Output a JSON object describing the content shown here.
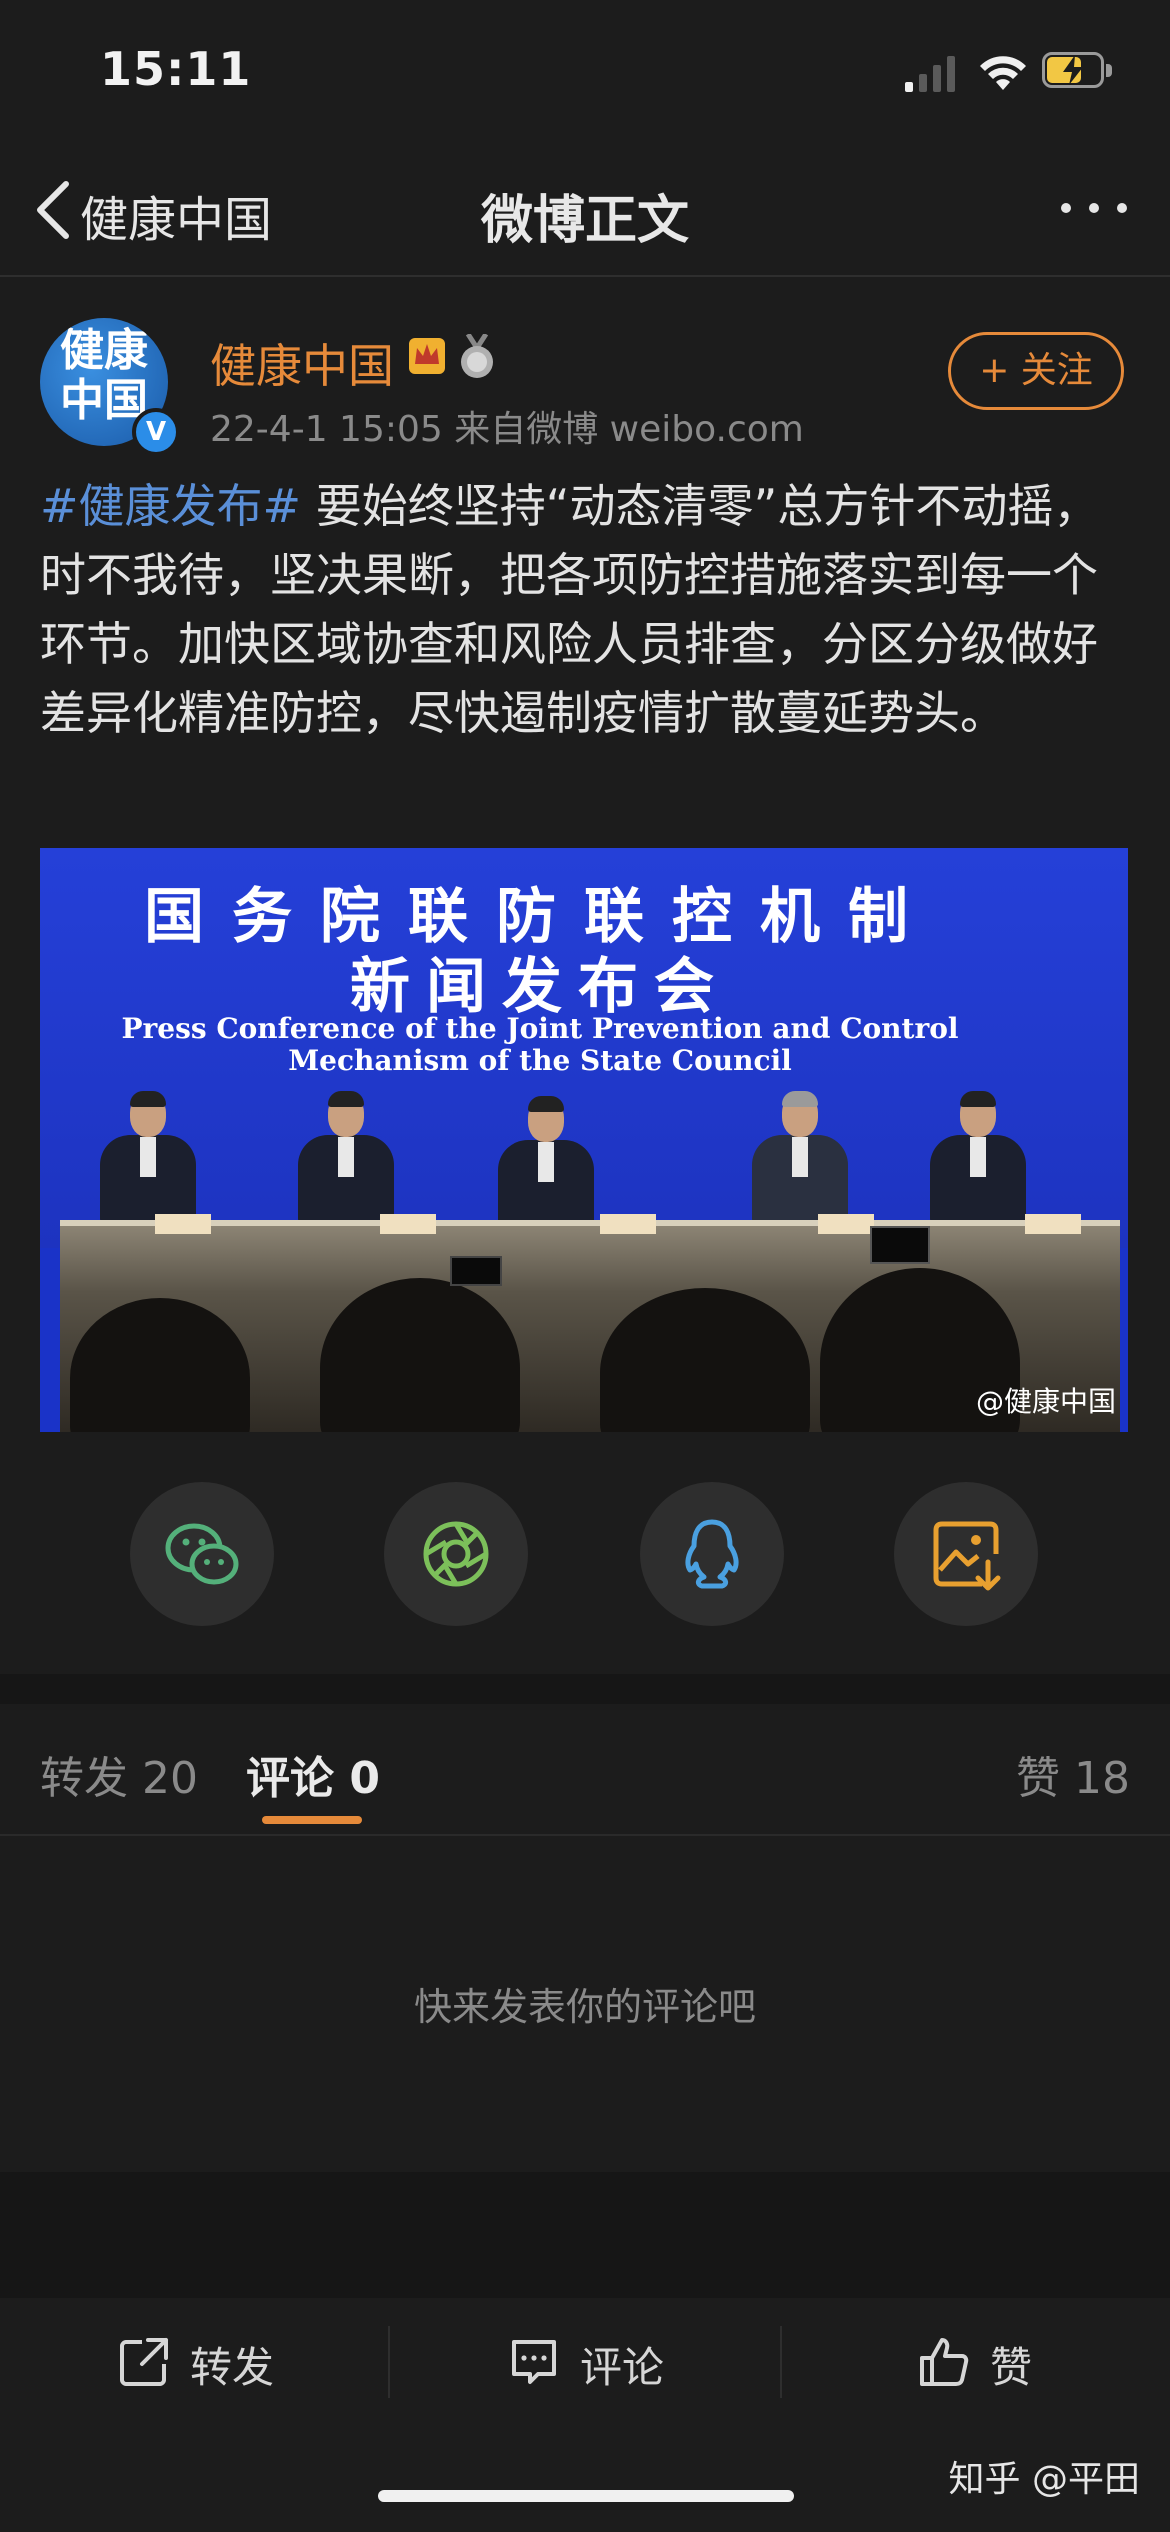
{
  "status_bar": {
    "time": "15:11"
  },
  "nav": {
    "back_label": "健康中国",
    "title": "微博正文"
  },
  "author": {
    "avatar_text": "健康中国",
    "name": "健康中国",
    "meta": "22-4-1 15:05  来自微博 weibo.com",
    "follow_label": "+ 关注"
  },
  "post": {
    "hashtag": "#健康发布#",
    "text": " 要始终坚持“动态清零”总方针不动摇，时不我待，坚决果断，把各项防控措施落实到每一个环节。加快区域协查和风险人员排查，分区分级做好差异化精准防控，尽快遏制疫情扩散蔓延势头。"
  },
  "image": {
    "title_cn_1": "国务院联防联控机制",
    "title_cn_2": "新闻发布会",
    "title_en_1": "Press Conference of the Joint Prevention and Control",
    "title_en_2": "Mechanism of the State Council",
    "watermark": "@健康中国"
  },
  "share": [
    "wechat-icon",
    "moments-icon",
    "qq-icon",
    "save-image-icon"
  ],
  "tabs": {
    "repost": "转发 20",
    "comments": "评论 0",
    "likes": "赞 18"
  },
  "empty_comments": "快来发表你的评论吧",
  "toolbar": {
    "repost": "转发",
    "comment": "评论",
    "like": "赞"
  },
  "footer_mark": "知乎 @平田",
  "colors": {
    "accent": "#e68a3a",
    "link": "#5a8fd8",
    "background": "#1c1c1c"
  }
}
